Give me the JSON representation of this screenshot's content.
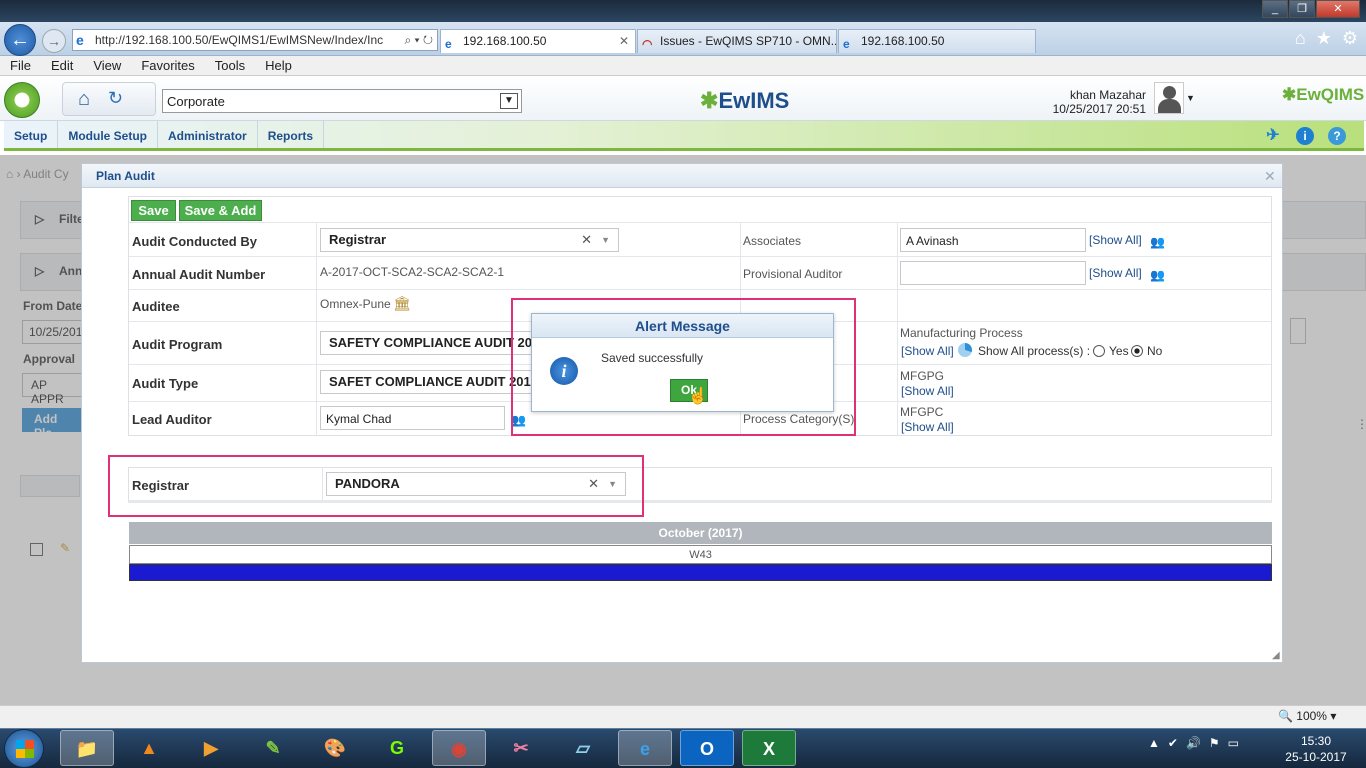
{
  "browser": {
    "address_url": "http://192.168.100.50/EwQIMS1/EwIMSNew/Index/Inc",
    "tabs": [
      {
        "label": "192.168.100.50",
        "active": true
      },
      {
        "label": "Issues - EwQIMS SP710 - OMN...",
        "active": false
      },
      {
        "label": "192.168.100.50",
        "active": false
      }
    ],
    "menu": [
      "File",
      "Edit",
      "View",
      "Favorites",
      "Tools",
      "Help"
    ],
    "zoom": "100%"
  },
  "header": {
    "company_select": "Corporate",
    "brand": "EwIMS",
    "brand_right": "EwQIMS",
    "user_name": "khan Mazahar",
    "datetime": "10/25/2017 20:51"
  },
  "nav": {
    "items": [
      "Setup",
      "Module Setup",
      "Administrator",
      "Reports"
    ]
  },
  "background": {
    "breadcrumb": "Audit Cy",
    "panel1": "Filte",
    "panel2": "Ann",
    "from_date_label": "From Date",
    "from_date_value": "10/25/201",
    "approval_label": "Approval",
    "approval_value": "AP APPR",
    "add_button": "Add Pla"
  },
  "modal": {
    "title": "Plan Audit",
    "save_label": "Save",
    "save_add_label": "Save & Add",
    "fields": {
      "audit_conducted_by_label": "Audit Conducted By",
      "audit_conducted_by_value": "Registrar",
      "annual_audit_number_label": "Annual Audit Number",
      "annual_audit_number_value": "A-2017-OCT-SCA2-SCA2-SCA2-1",
      "auditee_label": "Auditee",
      "auditee_value": "Omnex-Pune",
      "audit_program_label": "Audit Program",
      "audit_program_value": "SAFETY COMPLIANCE AUDIT 20",
      "audit_type_label": "Audit Type",
      "audit_type_value": "SAFET COMPLIANCE AUDIT 201",
      "lead_auditor_label": "Lead Auditor",
      "lead_auditor_value": "Kymal Chad",
      "associates_label": "Associates",
      "associates_value": "A Avinash",
      "provisional_auditor_label": "Provisional Auditor",
      "provisional_auditor_value": "",
      "show_all": "[Show All]",
      "manufacturing_process_label": "Manufacturing Process",
      "show_all_process_label": "Show All process(s) :",
      "yes": "Yes",
      "no": "No",
      "mfgpg": "MFGPG",
      "process_category_label": "Process Category(S)",
      "mfgpc": "MFGPC"
    },
    "registrar_label": "Registrar",
    "registrar_value": "PANDORA",
    "calendar_month": "October (2017)",
    "calendar_week": "W43"
  },
  "alert": {
    "title": "Alert Message",
    "message": "Saved successfully",
    "ok": "Ok"
  },
  "taskbar": {
    "time": "15:30",
    "date": "25-10-2017"
  }
}
